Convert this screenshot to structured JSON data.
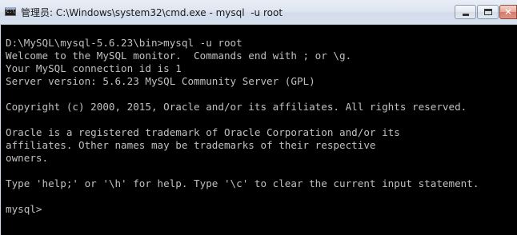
{
  "window": {
    "icon_text": "C:\\",
    "title": "管理员: C:\\Windows\\system32\\cmd.exe - mysql  -u root"
  },
  "console": {
    "lines": [
      "D:\\MySQL\\mysql-5.6.23\\bin>mysql -u root",
      "Welcome to the MySQL monitor.  Commands end with ; or \\g.",
      "Your MySQL connection id is 1",
      "Server version: 5.6.23 MySQL Community Server (GPL)",
      "",
      "Copyright (c) 2000, 2015, Oracle and/or its affiliates. All rights reserved.",
      "",
      "Oracle is a registered trademark of Oracle Corporation and/or its",
      "affiliates. Other names may be trademarks of their respective",
      "owners.",
      "",
      "Type 'help;' or '\\h' for help. Type '\\c' to clear the current input statement.",
      "",
      "mysql>"
    ]
  },
  "colors": {
    "console_bg": "#000000",
    "console_text": "#c0c0c0",
    "close_button": "#d4786a"
  },
  "icons": {
    "app": "cmd-icon",
    "minimize": "minimize-icon",
    "maximize": "maximize-icon",
    "close": "close-icon"
  }
}
